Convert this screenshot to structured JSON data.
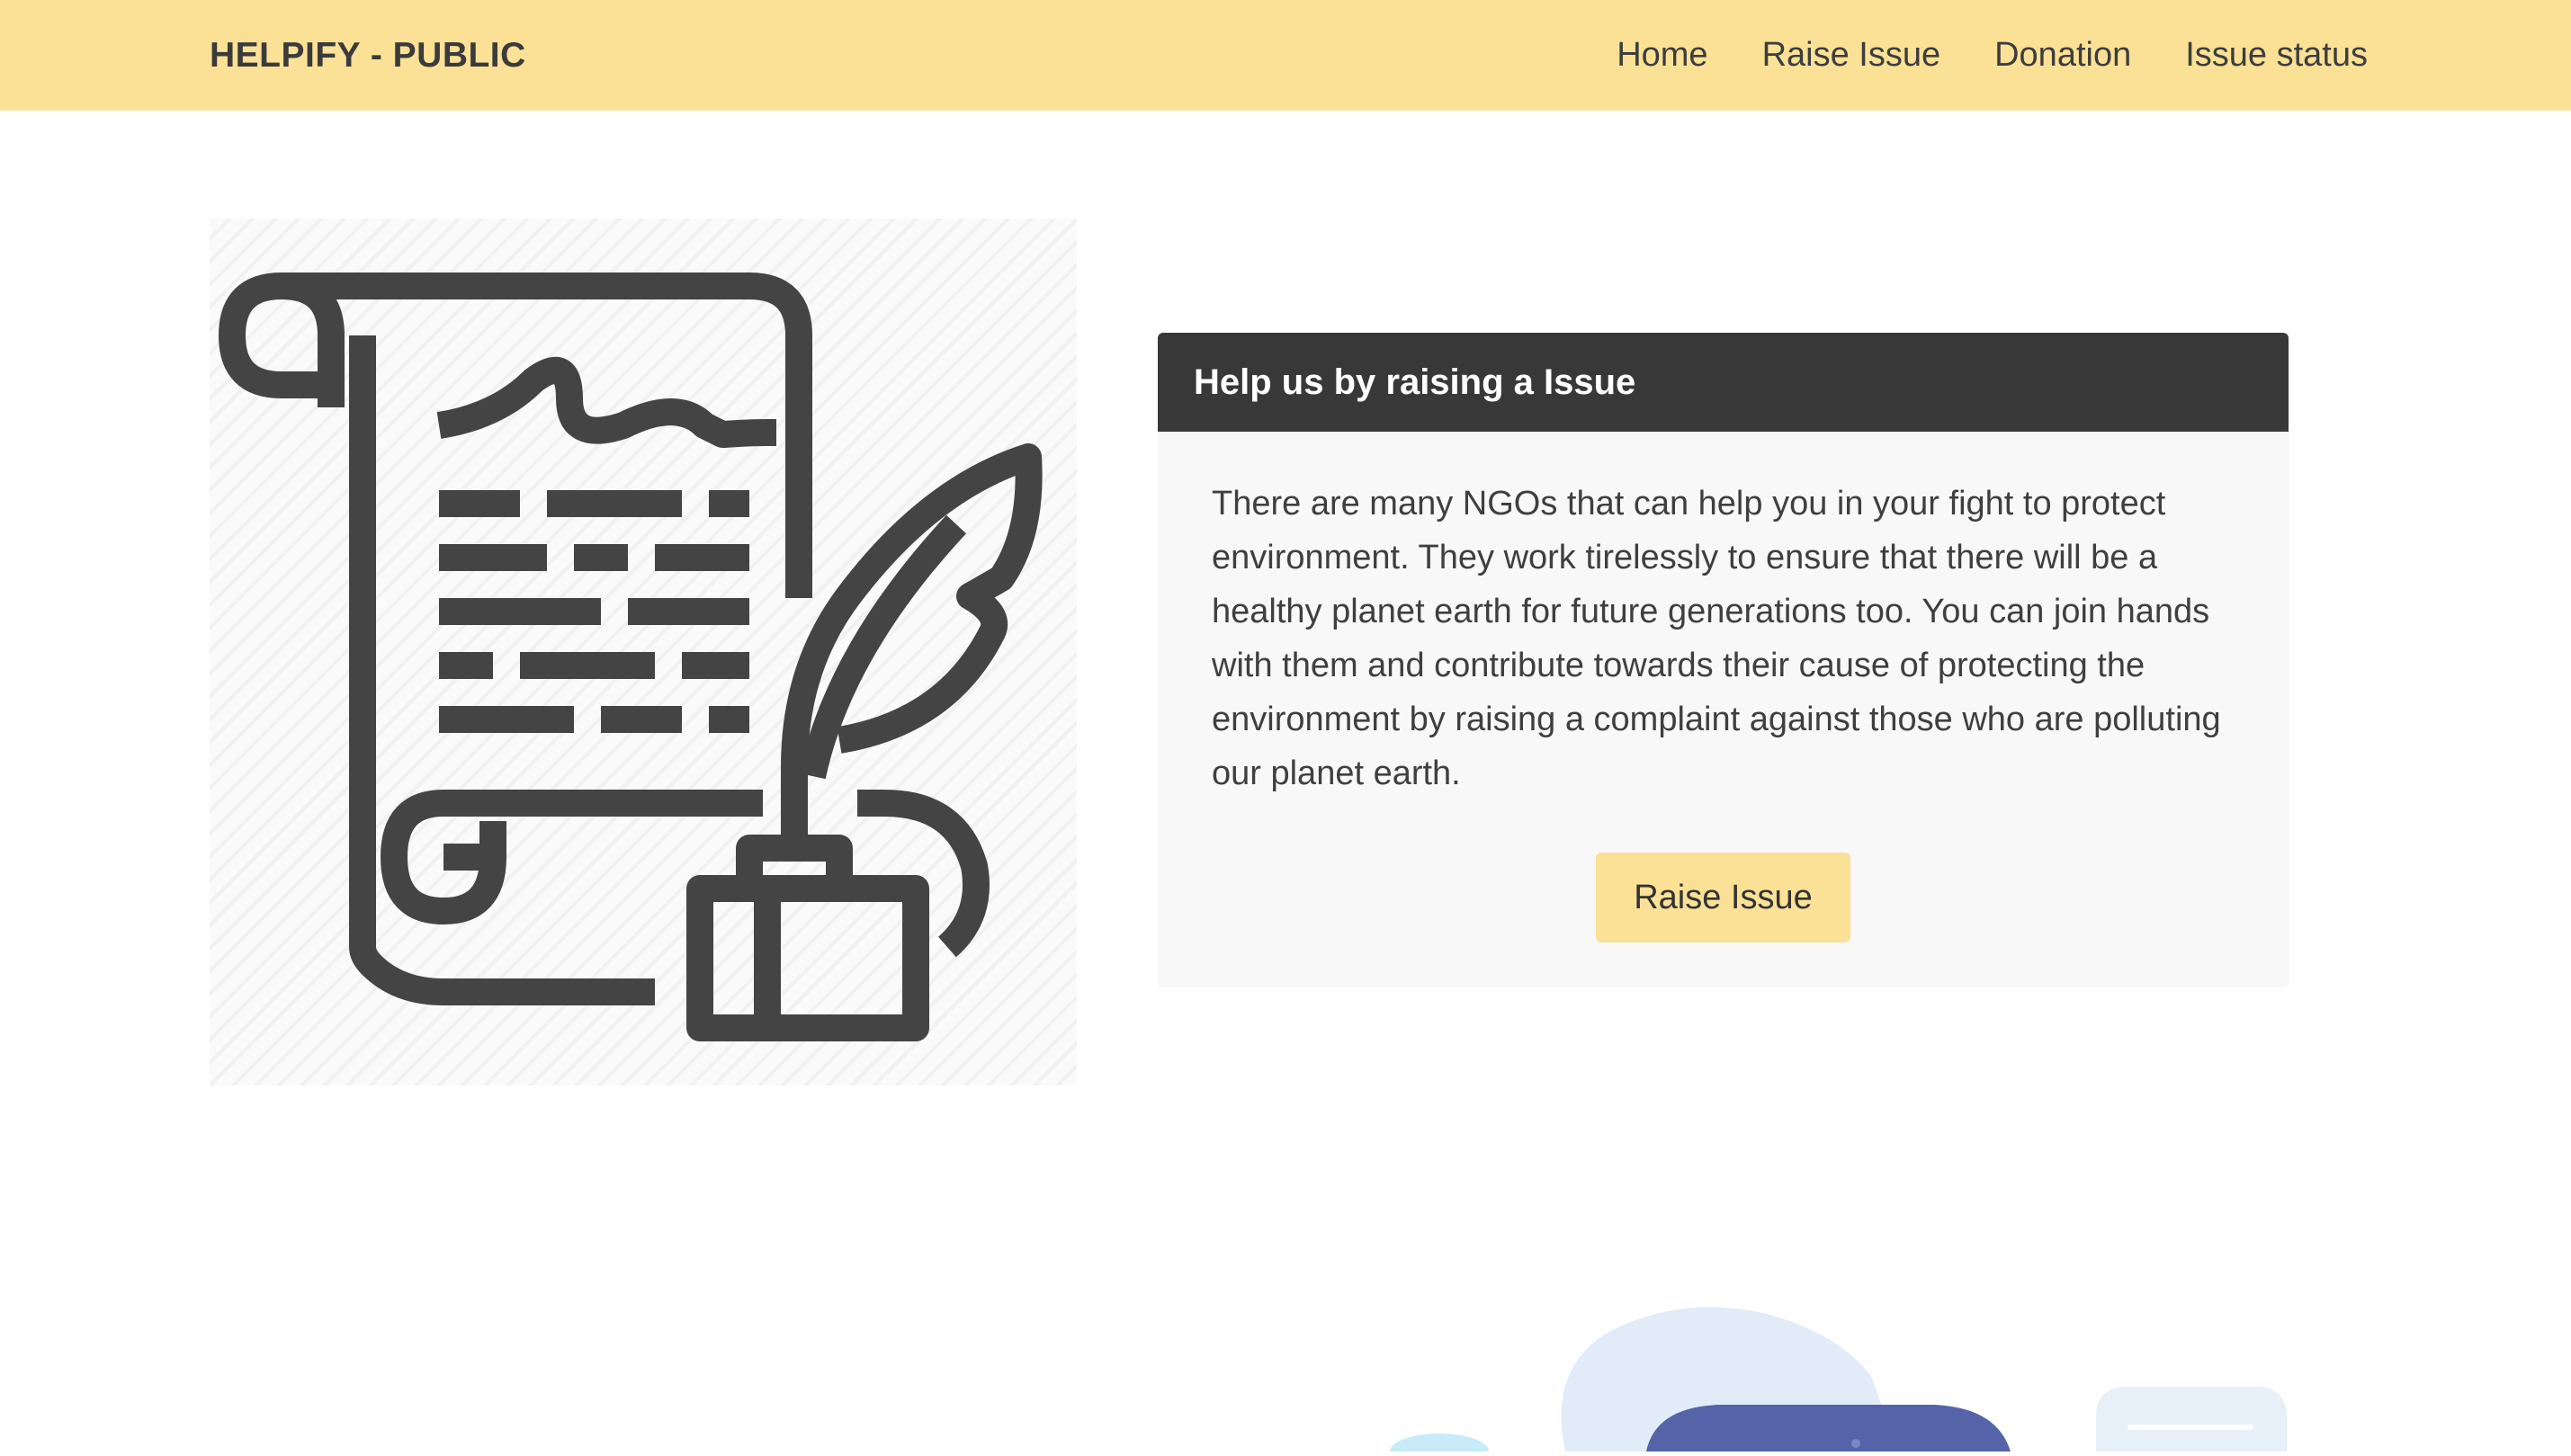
{
  "navbar": {
    "brand": "HELPIFY - PUBLIC",
    "links": [
      "Home",
      "Raise Issue",
      "Donation",
      "Issue status"
    ]
  },
  "hero": {
    "image_icon": "scroll-quill-ink-icon"
  },
  "card": {
    "title": "Help us by raising a Issue",
    "body": "There are many NGOs that can help you in your fight to protect environment. They work tirelessly to ensure that there will be a healthy planet earth for future generations too. You can join hands with them and contribute towards their cause of protecting the environment by raising a complaint against those who are polluting our planet earth.",
    "button_label": "Raise Issue"
  },
  "colors": {
    "navbar_bg": "#fbe196",
    "card_header_bg": "#383838",
    "card_bg": "#f8f8f8",
    "button_bg": "#fbe196",
    "icon_stroke": "#444444"
  },
  "bottom": {
    "illustration_icon": "people-chat-illustration"
  }
}
